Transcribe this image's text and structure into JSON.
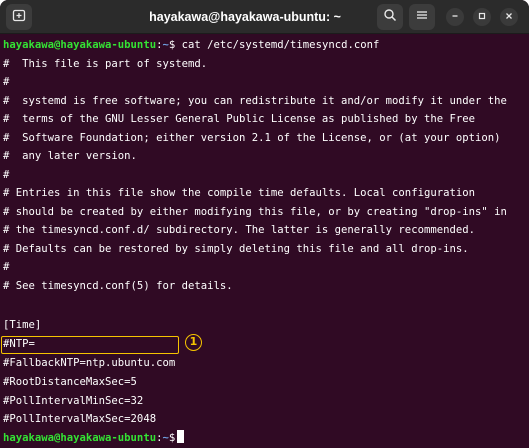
{
  "window": {
    "title": "hayakawa@hayakawa-ubuntu: ~"
  },
  "icons": {
    "new_tab": "new-tab-icon",
    "search": "search-icon",
    "menu": "hamburger-menu-icon",
    "minimize": "minimize-icon",
    "maximize": "maximize-icon",
    "close": "close-icon"
  },
  "colors": {
    "terminal_bg": "#300a24",
    "prompt_user": "#34e234",
    "prompt_path": "#6f9fdf",
    "highlight": "#f5c400"
  },
  "prompt": {
    "user_host": "hayakawa@hayakawa-ubuntu",
    "separator": ":",
    "path": "~",
    "symbol": "$"
  },
  "command": " cat /etc/systemd/timesyncd.conf",
  "output": [
    "#  This file is part of systemd.",
    "#",
    "#  systemd is free software; you can redistribute it and/or modify it under the",
    "#  terms of the GNU Lesser General Public License as published by the Free",
    "#  Software Foundation; either version 2.1 of the License, or (at your option)",
    "#  any later version.",
    "#",
    "# Entries in this file show the compile time defaults. Local configuration",
    "# should be created by either modifying this file, or by creating \"drop-ins\" in",
    "# the timesyncd.conf.d/ subdirectory. The latter is generally recommended.",
    "# Defaults can be restored by simply deleting this file and all drop-ins.",
    "#",
    "# See timesyncd.conf(5) for details.",
    "",
    "[Time]",
    "#NTP=",
    "#FallbackNTP=ntp.ubuntu.com",
    "#RootDistanceMaxSec=5",
    "#PollIntervalMinSec=32",
    "#PollIntervalMaxSec=2048"
  ],
  "annotation": {
    "label": "1"
  }
}
